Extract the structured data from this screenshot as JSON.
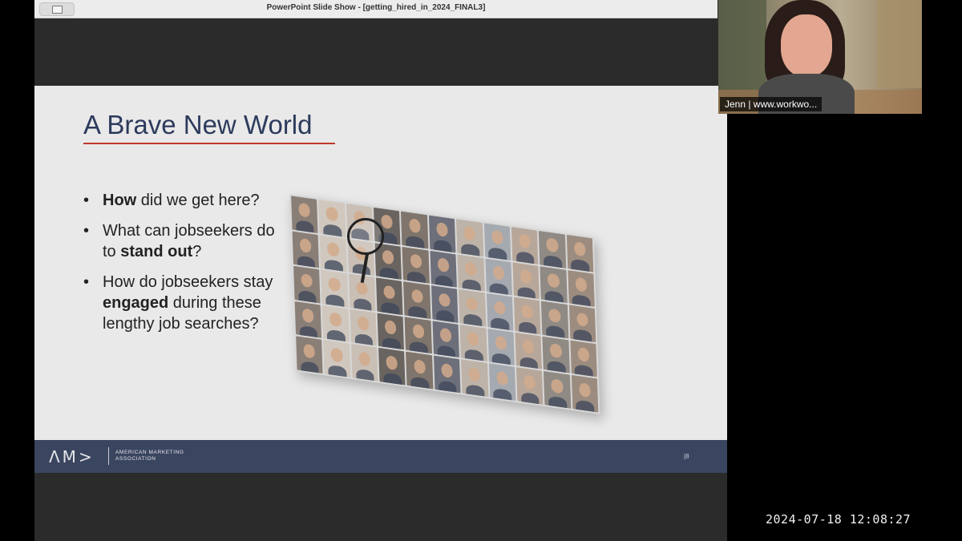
{
  "window": {
    "title": "PowerPoint Slide Show - [getting_hired_in_2024_FINAL3]",
    "icon": "slideshow-window-icon"
  },
  "slide": {
    "title": "A Brave New World",
    "bullets": [
      {
        "before": "",
        "bold": "How",
        "after": " did we get here?"
      },
      {
        "before": "What can jobseekers do to ",
        "bold": "stand out",
        "after": "?"
      },
      {
        "before": "How do jobseekers stay ",
        "bold": "engaged",
        "after": " during these lengthy job searches?"
      }
    ],
    "image": "faces-collage-with-magnifying-glass",
    "footer": {
      "logo": "AMA-logo",
      "org_name": "AMERICAN MARKETING ASSOCIATION",
      "page": "|8"
    },
    "colors": {
      "title": "#2d3a5c",
      "underline": "#c0392b",
      "footer": "#3a4560"
    }
  },
  "webcam": {
    "label": "Jenn | www.workwo..."
  },
  "timestamp": "2024-07-18  12:08:27"
}
